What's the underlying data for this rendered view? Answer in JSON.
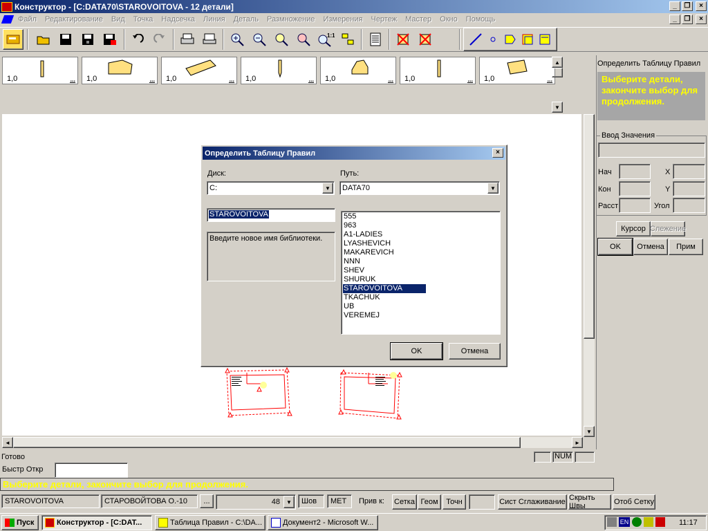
{
  "app": {
    "title": "Конструктор - [C:DATA70\\STAROVOITOVA  -  12 детали]"
  },
  "menu": [
    "Файл",
    "Редактирование",
    "Вид",
    "Точка",
    "Надсечка",
    "Линия",
    "Деталь",
    "Размножение",
    "Измерения",
    "Чертеж",
    "Мастер",
    "Окно",
    "Помощь"
  ],
  "pieces": {
    "label": "1,0",
    "more": "..."
  },
  "right_panel": {
    "title": "Определить Таблицу Правил",
    "prompt": "Выберите детали, закончите выбор для продолжения.",
    "input_group": "Ввод Значения",
    "labels": {
      "start": "Нач",
      "end": "Кон",
      "dist": "Расст",
      "x": "X",
      "y": "Y",
      "angle": "Угол"
    },
    "cursor_button": "Курсор",
    "tracking_button": "Слежение",
    "ok_button": "OK",
    "cancel_button": "Отмена",
    "apply_button": "Прим"
  },
  "dialog": {
    "title": "Определить Таблицу Правил",
    "disk_label": "Диск:",
    "disk_value": "C:",
    "path_label": "Путь:",
    "path_value": "DATA70",
    "name_value": "STAROVOITOVA",
    "hint": "Введите новое имя библиотеки.",
    "list": [
      "555",
      "963",
      "A1-LADIES",
      "LYASHEVICH",
      "MAKAREVICH",
      "NNN",
      "SHEV",
      "SHURUK",
      "STAROVOITOVA",
      "TKACHUK",
      "UB",
      "VEREMEJ"
    ],
    "selected_index": 8,
    "ok": "OK",
    "cancel": "Отмена"
  },
  "status": {
    "ready": "Готово",
    "num": "NUM",
    "quick_open_label": "Быстр Откр",
    "message": "Выберите детали, закончите выбор для продолжения.",
    "field1": "STAROVOITOVA",
    "field2": "СТАРОВОЙТОВА О.-10",
    "more_button": "...",
    "size_value": "48",
    "seam": "Шов",
    "met": "МЕТ",
    "snap_label": "Прив к:",
    "grid": "Сетка",
    "geom": "Геом",
    "point": "Точн",
    "smoothing": "Сист Сглаживание",
    "hide_seam": "Скрыть Швы",
    "show_grid": "Отоб Сетку"
  },
  "taskbar": {
    "start": "Пуск",
    "tasks": [
      "Конструктор - [C:DAT...",
      "Таблица Правил - C:\\DA...",
      "Документ2 - Microsoft W..."
    ],
    "lang": "EN",
    "clock": "11:17"
  },
  "colors": {
    "title_start": "#0a246a",
    "title_end": "#a6caf0",
    "prompt_text": "#ffff00",
    "selection": "#0a246a",
    "piece_red": "#ff0000"
  }
}
